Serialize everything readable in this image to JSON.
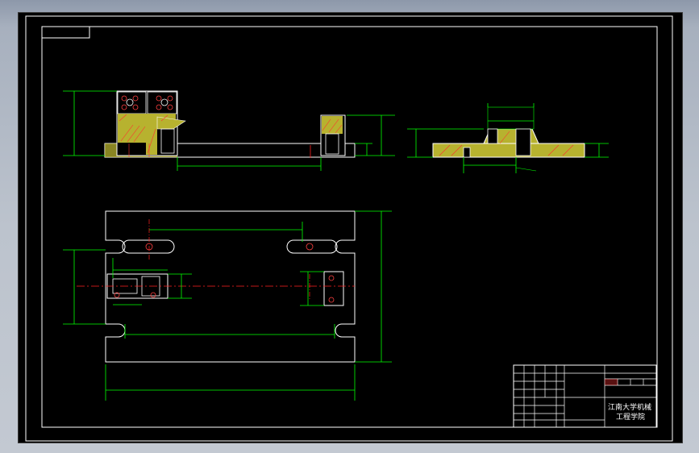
{
  "window": {
    "background_color": "#b8c0cb",
    "canvas_color": "#000000"
  },
  "colors": {
    "outline": "#ffffff",
    "dimension": "#00ff00",
    "section_fill": "#b7b22f",
    "hatch": "#ff3030",
    "centerline": "#ff2020",
    "detail": "#ff4040"
  },
  "title_block": {
    "drawing_name": "",
    "school_line1": "江南大学机械",
    "school_line2": "工程学院"
  }
}
